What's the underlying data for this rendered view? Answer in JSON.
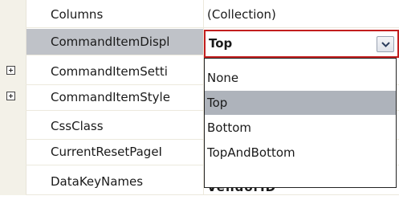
{
  "property_rows": [
    {
      "name": "Columns",
      "value": "(Collection)",
      "expandable": false
    },
    {
      "name": "CommandItemDispl",
      "value": "Top",
      "expandable": false,
      "selected": true
    },
    {
      "name": "CommandItemSetti",
      "value": "",
      "expandable": true
    },
    {
      "name": "CommandItemStyle",
      "value": "",
      "expandable": true
    },
    {
      "name": "CssClass",
      "value": "",
      "expandable": false
    },
    {
      "name": "CurrentResetPageI",
      "value": "",
      "expandable": false
    },
    {
      "name": "DataKeyNames",
      "value": "VendorID",
      "expandable": false
    }
  ],
  "combo": {
    "selected_value": "Top",
    "button_icon": "chevron-down-icon"
  },
  "dropdown_options": [
    "None",
    "Top",
    "Bottom",
    "TopAndBottom"
  ],
  "dropdown_highlighted": "Top",
  "colors": {
    "highlight_border": "#c21e1e",
    "selected_row_bg": "#bfc2c8",
    "option_highlight_bg": "#aeb3bb",
    "margin_bg": "#f3f1e8"
  }
}
